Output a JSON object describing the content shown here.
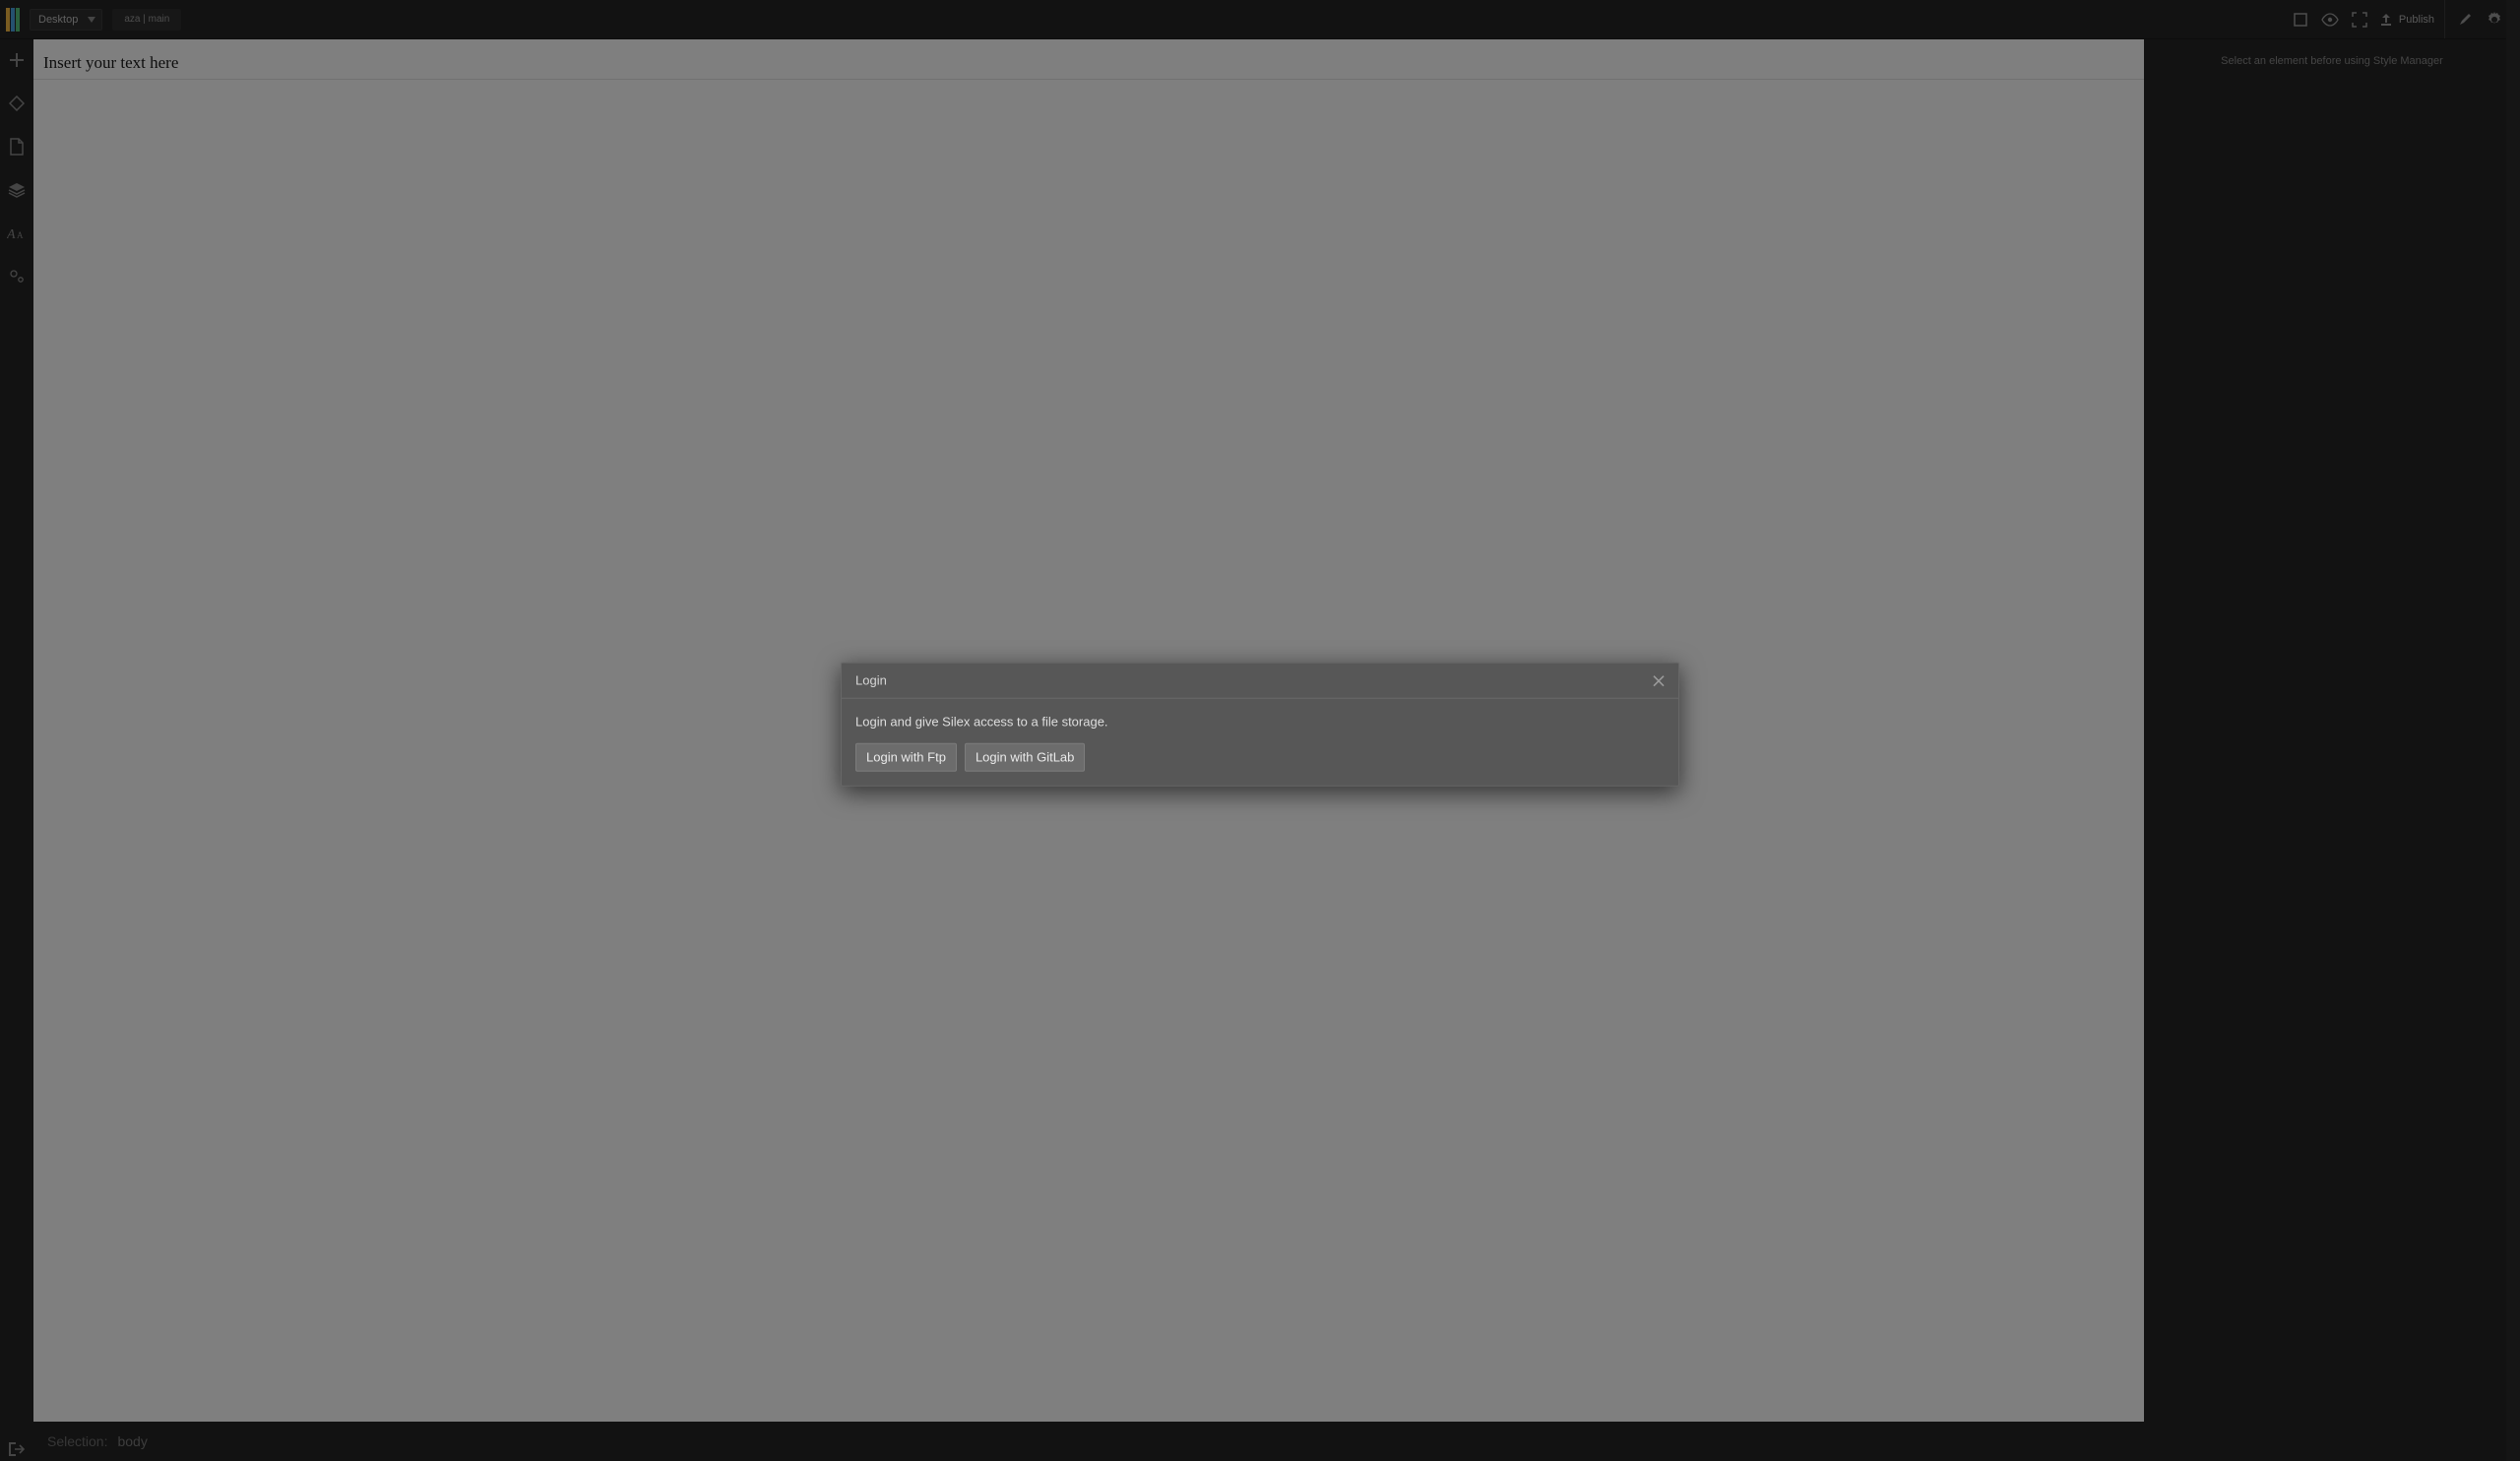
{
  "topbar": {
    "device_label": "Desktop",
    "breadcrumb": "aza | main",
    "publish_label": "Publish"
  },
  "canvas": {
    "placeholder_text": "Insert your text here"
  },
  "rightpanel": {
    "empty_message": "Select an element before using Style Manager"
  },
  "statusbar": {
    "selection_label": "Selection:",
    "selection_value": "body"
  },
  "modal": {
    "title": "Login",
    "message": "Login and give Silex access to a file storage.",
    "buttons": {
      "ftp": "Login with Ftp",
      "gitlab": "Login with GitLab"
    }
  },
  "icons": {
    "logo": "silex-logo",
    "add": "plus-icon",
    "diamond": "ruby-icon",
    "page": "page-icon",
    "layers": "layers-icon",
    "typography": "typography-icon",
    "settings_small": "cogs-icon",
    "exit": "exit-icon",
    "outline": "outline-icon",
    "eye": "eye-icon",
    "fullscreen": "fullscreen-icon",
    "upload": "upload-icon",
    "brush": "brush-icon",
    "gear": "gear-icon",
    "close": "close-icon",
    "caret": "caret-down-icon"
  }
}
